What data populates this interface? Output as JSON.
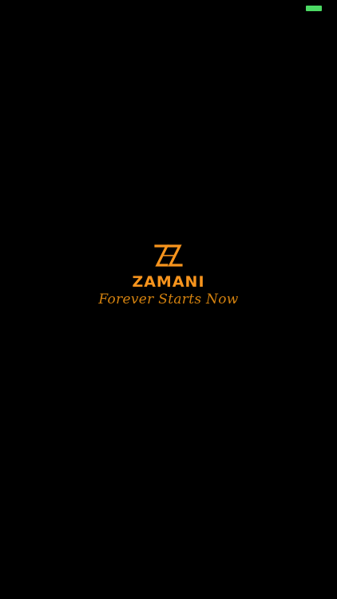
{
  "colors": {
    "background": "#000000",
    "brand_orange": "#F7941D",
    "tagline_orange": "#D4820F",
    "battery_green": "#4CD964"
  },
  "status_bar": {
    "battery_icon": "battery-icon"
  },
  "splash": {
    "logo_icon": "zamani-logo-icon",
    "brand_name": "ZAMANI",
    "tagline": "Forever Starts Now"
  }
}
